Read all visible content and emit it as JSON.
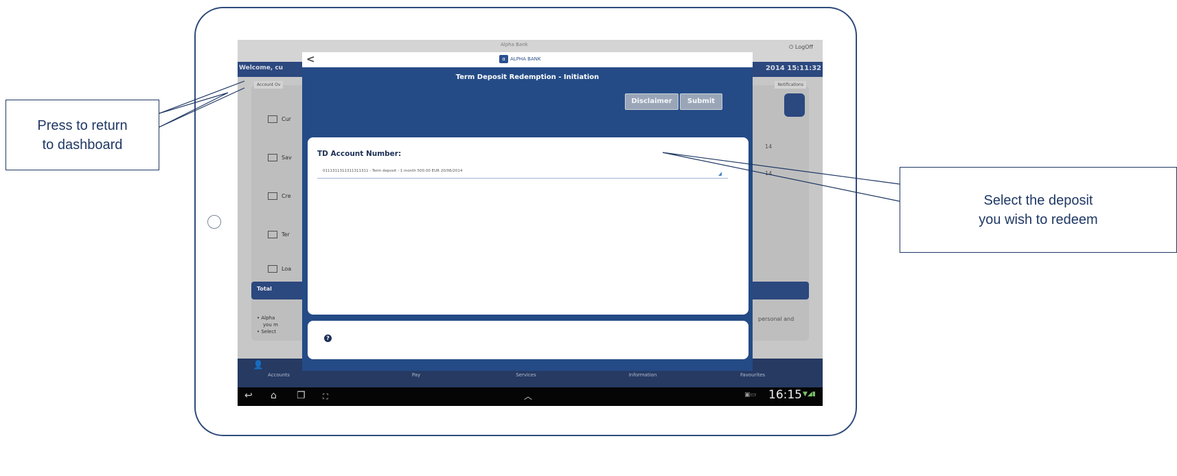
{
  "background_app": {
    "top_brand": "Alpha Bank",
    "logout": "LogOff",
    "welcome": "Welcome, cu",
    "datetime": "2014 15:11:32",
    "tab_left": "Account Ov",
    "tab_right": "Notifications",
    "menu_items": [
      "Cur",
      "Sav",
      "Cre",
      "Ter",
      "Loa"
    ],
    "total_label": "Total",
    "right_values": [
      "14",
      "14"
    ],
    "bullets": [
      "Alpha",
      "you m",
      "Select"
    ],
    "bullet_right": "personal and",
    "bottom_nav": [
      "Accounts",
      "Pay",
      "Services",
      "Information",
      "Favourites"
    ]
  },
  "system_bar": {
    "clock": "16:15"
  },
  "modal": {
    "logo_text": "ALPHA BANK",
    "title": "Term Deposit Redemption - Initiation",
    "disclaimer_button": "Disclaimer",
    "submit_button": "Submit",
    "field_label": "TD Account Number:",
    "field_value": "0111311311311311311 - Term deposit - 1 month 500.00 EUR 20/06/2014"
  },
  "callouts": {
    "left": "Press to return\nto dashboard",
    "right": "Select the deposit\nyou wish to redeem"
  },
  "colors": {
    "frame": "#2f4b7c",
    "modal_blue": "#244b86",
    "callout_text": "#1f3864"
  }
}
